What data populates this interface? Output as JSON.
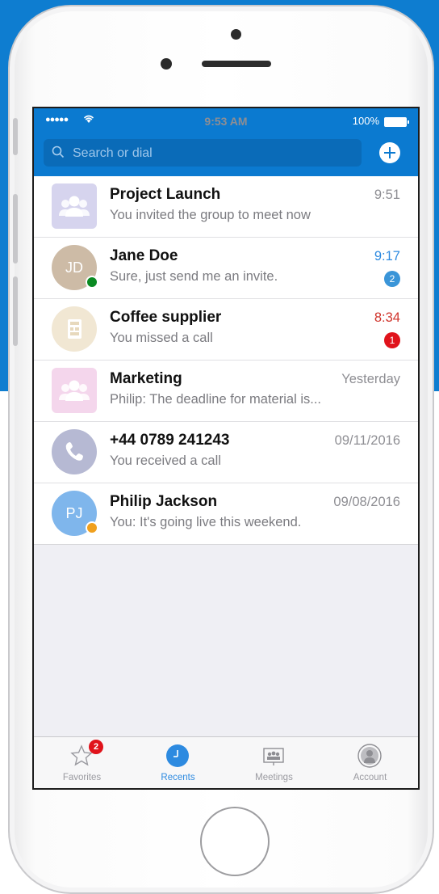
{
  "colors": {
    "brand": "#0b7ad0",
    "presence_online": "#0a8a22",
    "presence_away": "#f0a01e",
    "badge_blue": "#3a95d8",
    "badge_red": "#e0131b",
    "missed_time": "#d0342c",
    "unread_time": "#2d8ae0"
  },
  "status_bar": {
    "signal": "●●●●● ",
    "time": "9:53 AM",
    "battery": "100%"
  },
  "search": {
    "placeholder": "Search or dial"
  },
  "conversations": [
    {
      "name": "Project Launch",
      "preview": "You invited the group to meet now",
      "time": "9:51",
      "avatar": "group-icon",
      "avatar_color": "#d6d4ee"
    },
    {
      "name": "Jane Doe",
      "preview": "Sure, just send me an invite.",
      "time": "9:17",
      "initials": "JD",
      "avatar_color": "#cdbba6",
      "presence": "online",
      "badge": "2"
    },
    {
      "name": "Coffee supplier",
      "preview": "You missed a call",
      "time": "8:34",
      "avatar": "contact-card-icon",
      "avatar_color": "#f1e7d3",
      "badge": "1"
    },
    {
      "name": "Marketing",
      "preview": "Philip: The deadline for material is...",
      "time": "Yesterday",
      "avatar": "group-icon",
      "avatar_color": "#f4d6ec"
    },
    {
      "name": "+44 0789 241243",
      "preview": "You received a call",
      "time": "09/11/2016",
      "avatar": "phone-icon",
      "avatar_color": "#b6b9d3"
    },
    {
      "name": "Philip Jackson",
      "preview": "You: It's going live this weekend.",
      "time": "09/08/2016",
      "initials": "PJ",
      "avatar_color": "#7fb6ec",
      "presence": "away"
    }
  ],
  "tabs": [
    {
      "label": "Favorites",
      "icon": "star-icon",
      "badge": "2"
    },
    {
      "label": "Recents",
      "icon": "clock-icon",
      "active": true
    },
    {
      "label": "Meetings",
      "icon": "meeting-icon"
    },
    {
      "label": "Account",
      "icon": "account-icon"
    }
  ]
}
